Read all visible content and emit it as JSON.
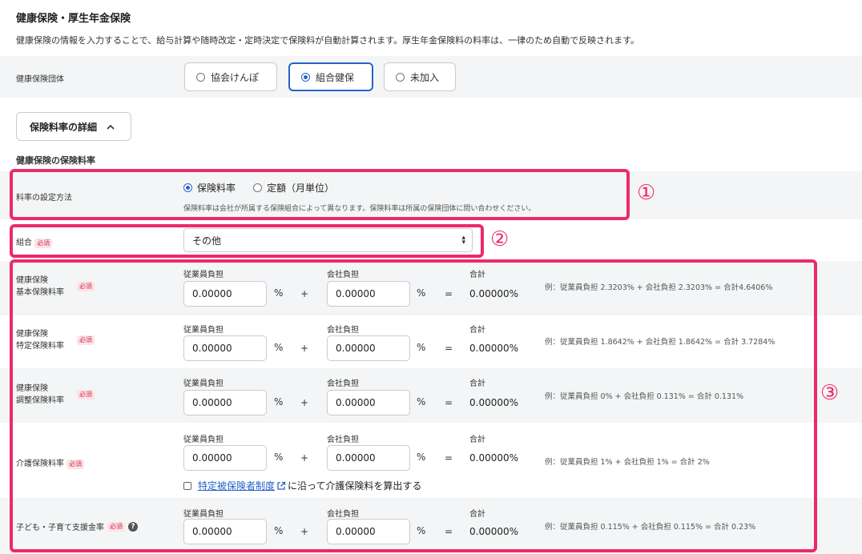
{
  "header": {
    "title": "健康保険・厚生年金保険",
    "description": "健康保険の情報を入力することで、給与計算や随時改定・定時決定で保険料が自動計算されます。厚生年金保険料の料率は、一律のため自動で反映されます。"
  },
  "insurer_group": {
    "label": "健康保険団体",
    "options": [
      "協会けんぽ",
      "組合健保",
      "未加入"
    ],
    "selected": "組合健保"
  },
  "details_toggle": {
    "label": "保険料率の詳細",
    "icon": "chevron-up-icon"
  },
  "section_title": "健康保険の保険料率",
  "rate_method": {
    "label": "料率の設定方法",
    "options": [
      "保険料率",
      "定額（月単位）"
    ],
    "selected": "保険料率",
    "note": "保険料率は会社が所属する保険組合によって異なります。保険料率は所属の保険団体に問い合わせください。"
  },
  "union": {
    "label": "組合",
    "required": "必須",
    "value": "その他"
  },
  "common": {
    "employee_label": "従業員負担",
    "company_label": "会社負担",
    "total_label": "合計",
    "percent": "%",
    "plus": "+",
    "equals": "="
  },
  "rates": [
    {
      "label_line1": "健康保険",
      "label_line2": "基本保険料率",
      "required": "必須",
      "employee": "0.00000",
      "company": "0.00000",
      "total": "0.00000%",
      "example": "例：従業員負担 2.3203% + 会社負担 2.3203% = 合計4.6406%"
    },
    {
      "label_line1": "健康保険",
      "label_line2": "特定保険料率",
      "required": "必須",
      "employee": "0.00000",
      "company": "0.00000",
      "total": "0.00000%",
      "example": "例：従業員負担 1.8642% + 会社負担 1.8642% = 合計 3.7284%"
    },
    {
      "label_line1": "健康保険",
      "label_line2": "調整保険料率",
      "required": "必須",
      "employee": "0.00000",
      "company": "0.00000",
      "total": "0.00000%",
      "example": "例：従業員負担 0% + 会社負担 0.131% = 合計 0.131%"
    },
    {
      "label_line1": "介護保険料率",
      "label_line2": "",
      "required": "必須",
      "employee": "0.00000",
      "company": "0.00000",
      "total": "0.00000%",
      "example": "例：従業員負担 1% + 会社負担 1% = 合計 2%"
    },
    {
      "label_line1": "子ども・子育て支援金率",
      "label_line2": "",
      "required": "必須",
      "employee": "0.00000",
      "company": "0.00000",
      "total": "0.00000%",
      "example": "例：従業員負担 0.115% + 会社負担 0.115% = 合計 0.23%"
    }
  ],
  "care_checkbox": {
    "link_text": "特定被保険者制度",
    "rest_text": "に沿って介護保険料を算出する"
  },
  "annotations": {
    "n1": "①",
    "n2": "②",
    "n3": "③"
  },
  "colors": {
    "highlight": "#ec2a6a",
    "accent": "#2563c8",
    "row_bg": "#f4f5f6"
  }
}
